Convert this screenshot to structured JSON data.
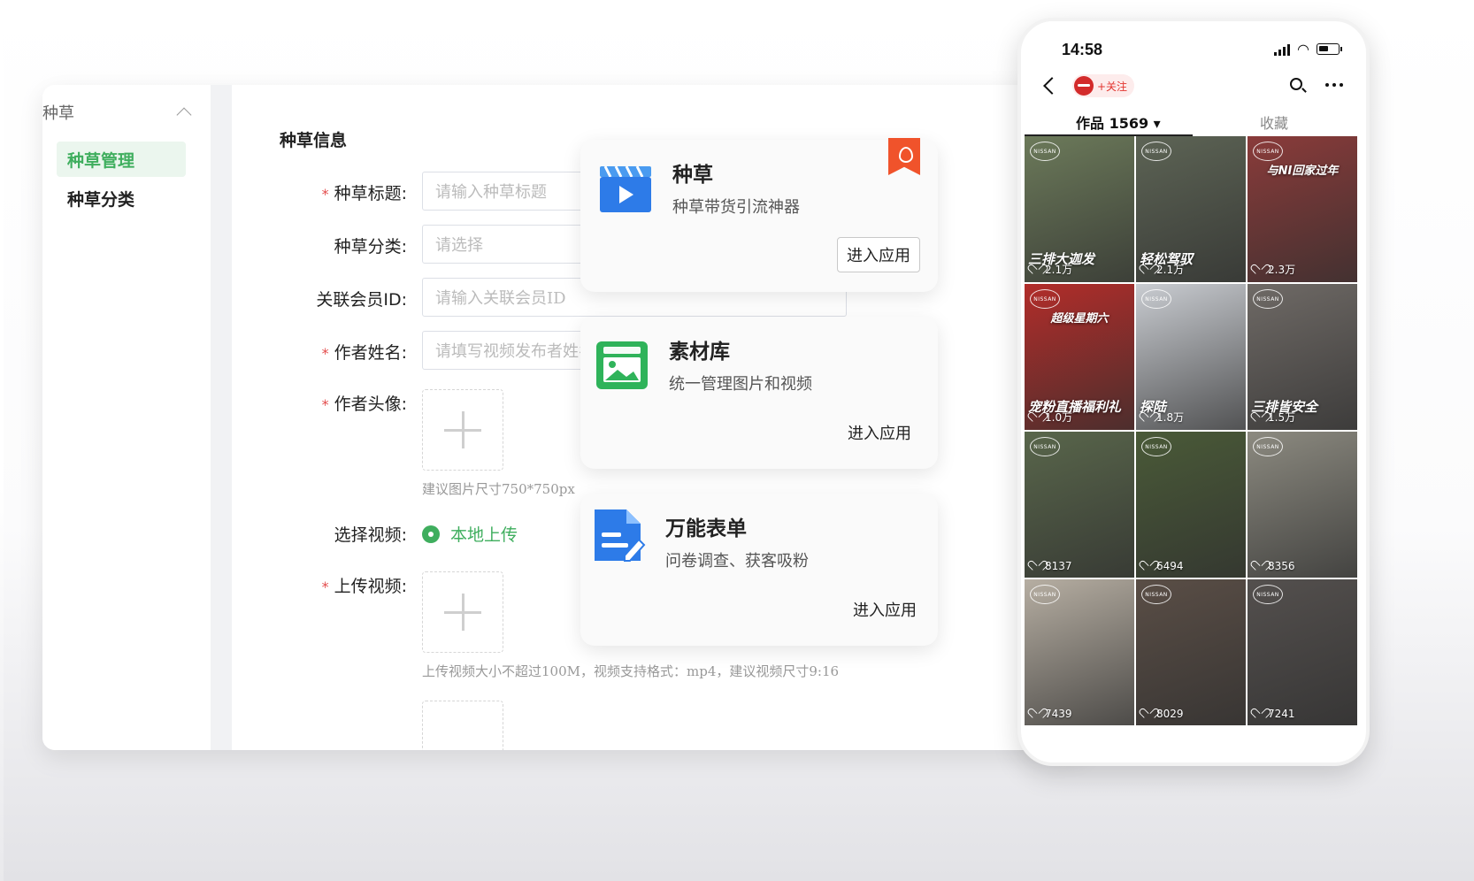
{
  "sidebar": {
    "group_label": "种草",
    "items": [
      {
        "label": "种草管理",
        "active": true
      },
      {
        "label": "种草分类",
        "active": false
      }
    ]
  },
  "form": {
    "section_title": "种草信息",
    "fields": {
      "title": {
        "label": "种草标题:",
        "placeholder": "请输入种草标题",
        "required": true
      },
      "category": {
        "label": "种草分类:",
        "placeholder": "请选择",
        "required": false
      },
      "member_id": {
        "label": "关联会员ID:",
        "placeholder": "请输入关联会员ID",
        "required": false
      },
      "author_name": {
        "label": "作者姓名:",
        "placeholder": "请填写视频发布者姓名",
        "required": true
      },
      "avatar": {
        "label": "作者头像:",
        "hint": "建议图片尺寸750*750px",
        "required": true
      },
      "video_source": {
        "label": "选择视频:",
        "option": "本地上传"
      },
      "video_upload": {
        "label": "上传视频:",
        "hint": "上传视频大小不超过100M，视频支持格式：mp4，建议视频尺寸9:16",
        "required": true
      }
    },
    "required_mark": "*"
  },
  "cards": [
    {
      "title": "种草",
      "desc": "种草带货引流神器",
      "button": "进入应用",
      "icon": "play-video-icon"
    },
    {
      "title": "素材库",
      "desc": "统一管理图片和视频",
      "button": "进入应用",
      "icon": "image-library-icon"
    },
    {
      "title": "万能表单",
      "desc": "问卷调查、获客吸粉",
      "button": "进入应用",
      "icon": "form-document-icon"
    }
  ],
  "phone": {
    "time": "14:58",
    "follow_label": "+关注",
    "tab_works": "作品 1569 ▾",
    "tab_collect": "收藏",
    "brand": "NISSAN",
    "videos": [
      {
        "likes": "2.1万",
        "caption": "三排大迦发",
        "top": "",
        "bg": "#6c7a5a"
      },
      {
        "likes": "2.1万",
        "caption": "轻松驾驭",
        "top": "",
        "bg": "#5d6455"
      },
      {
        "likes": "2.3万",
        "caption": "",
        "top": "与NI回家过年",
        "bg": "#8a3b3a"
      },
      {
        "likes": "1.0万",
        "caption": "宠粉直播福利礼",
        "top": "超级星期六",
        "bg": "#b22d2a"
      },
      {
        "likes": "1.8万",
        "caption": "探陆",
        "top": "",
        "bg": "#c9ccd1"
      },
      {
        "likes": "1.5万",
        "caption": "三排皆安全",
        "top": "",
        "bg": "#6f6a66"
      },
      {
        "likes": "8137",
        "caption": "",
        "top": "",
        "bg": "#59664b"
      },
      {
        "likes": "6494",
        "caption": "",
        "top": "",
        "bg": "#4a5a38"
      },
      {
        "likes": "8356",
        "caption": "",
        "top": "",
        "bg": "#8c8a80"
      },
      {
        "likes": "7439",
        "caption": "",
        "top": "",
        "bg": "#b6aea2"
      },
      {
        "likes": "8029",
        "caption": "",
        "top": "",
        "bg": "#5a4e46"
      },
      {
        "likes": "7241",
        "caption": "",
        "top": "",
        "bg": "#54504e"
      }
    ]
  }
}
